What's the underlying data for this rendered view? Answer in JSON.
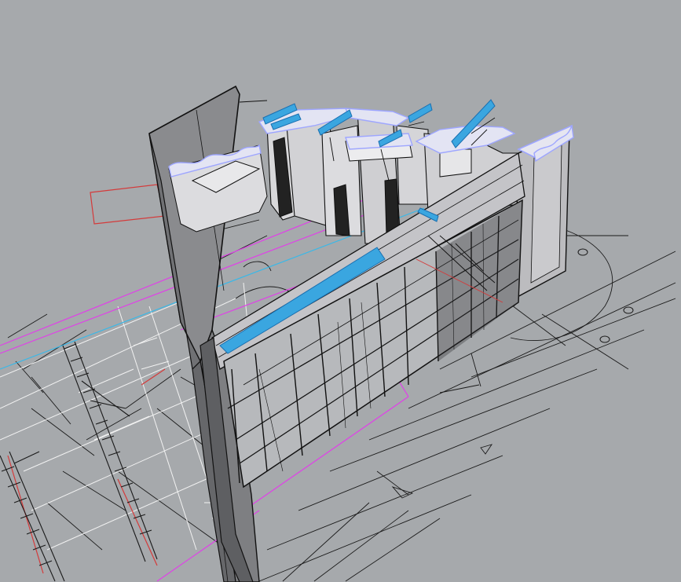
{
  "viewport": {
    "view": "perspective",
    "display_mode": "shaded-wireframe",
    "background_color": "#a6a9ac"
  },
  "colors": {
    "wall_fill": "#cfcfd2",
    "wall_dark": "#8a8b8e",
    "edge": "#111111",
    "curtain_edge": "#9ea6ff",
    "mullion_blue": "#3aa6e0",
    "sketch_white": "#f2f2f2",
    "grid_magenta": "#e040e8",
    "grid_cyan": "#39b8e8",
    "section_red": "#d43a3a"
  },
  "model": {
    "object": "building-section-model",
    "elements": [
      "facade-wall",
      "roof-slab",
      "curtain-wall",
      "stair",
      "plan-linework",
      "column"
    ]
  }
}
